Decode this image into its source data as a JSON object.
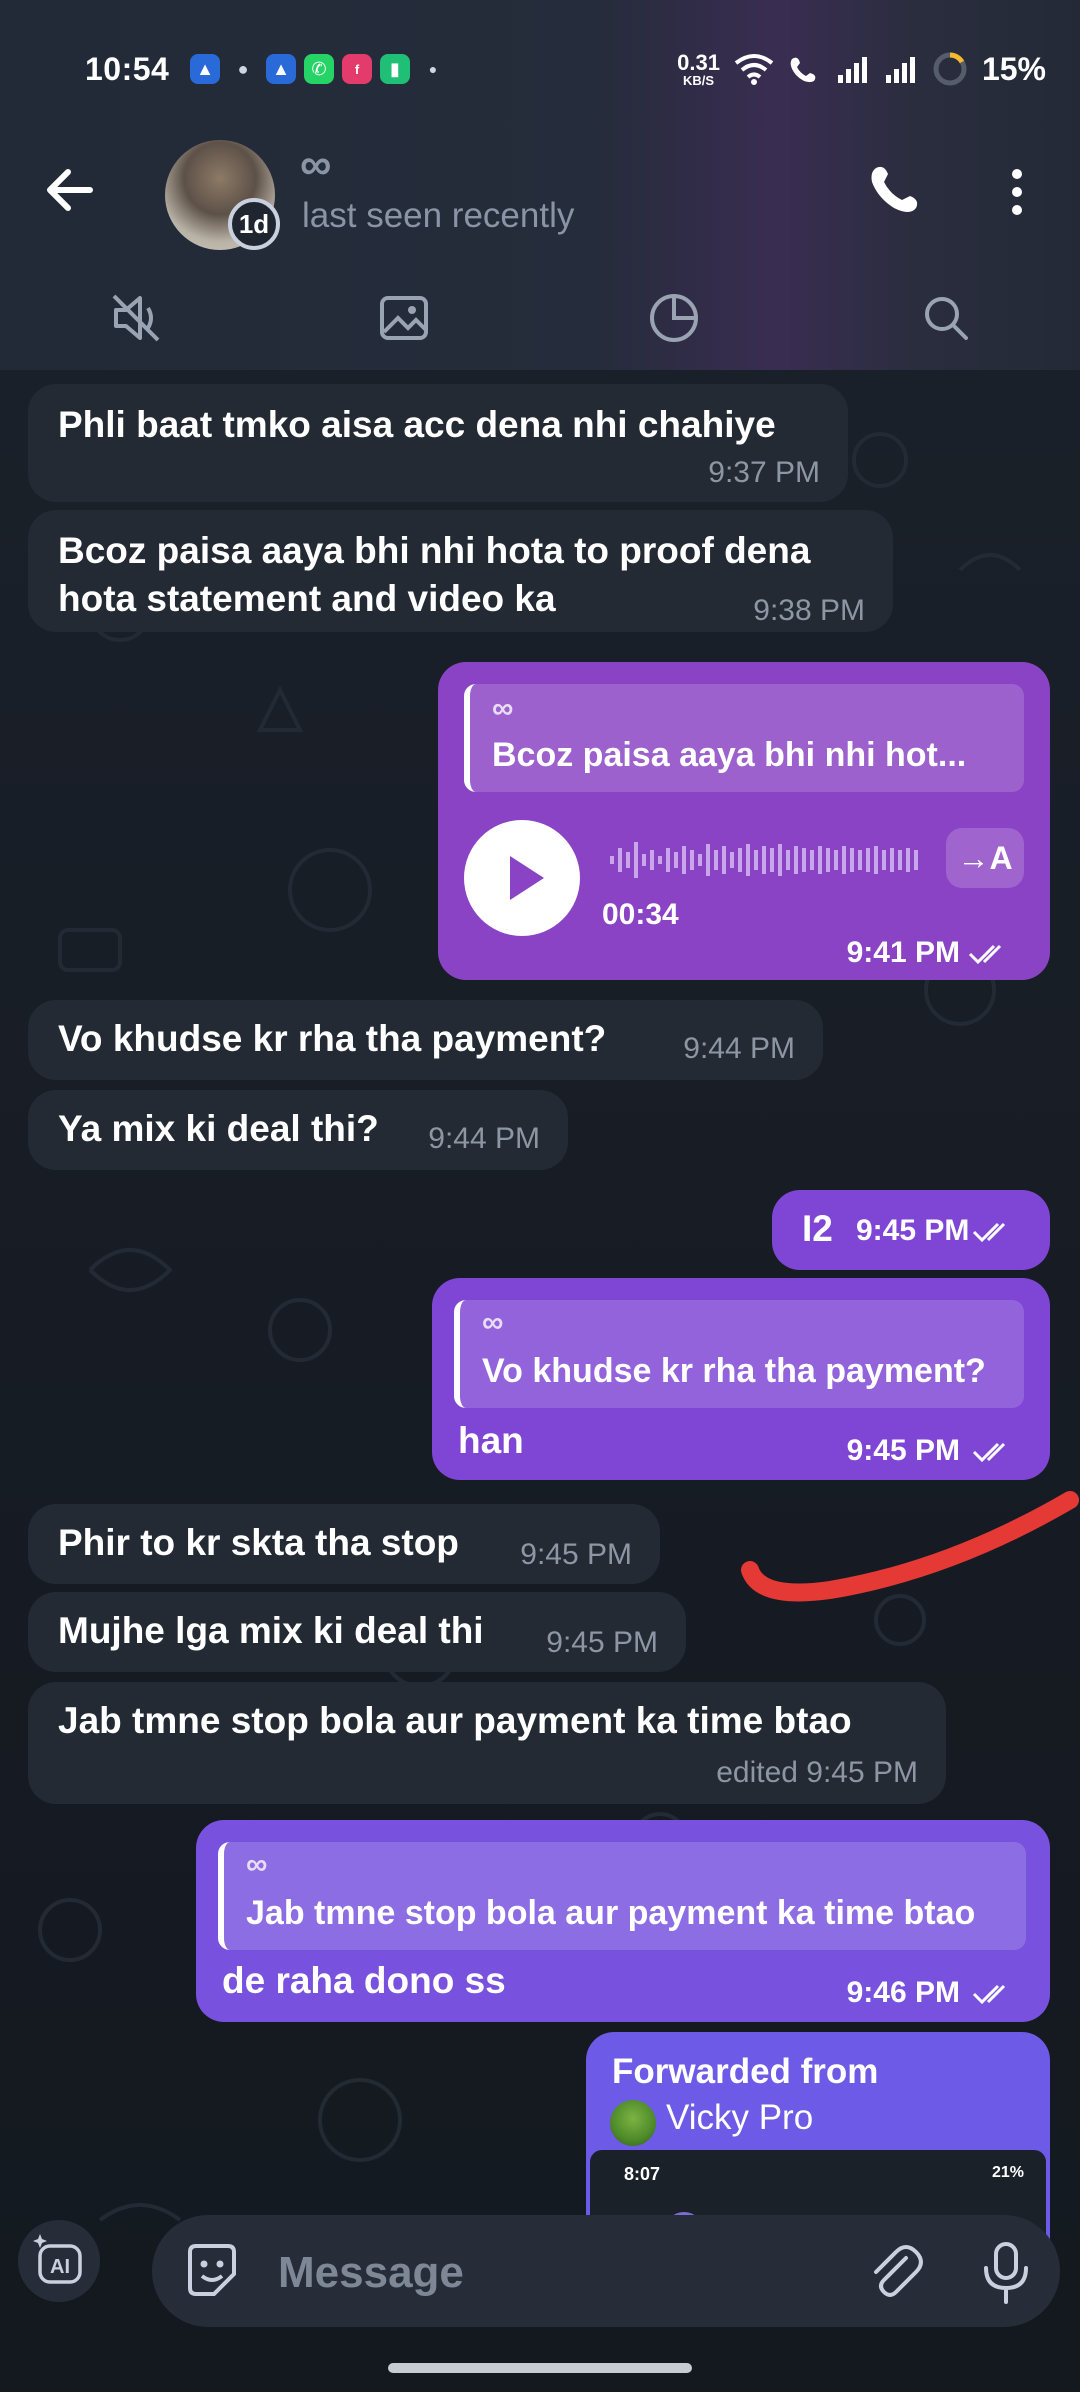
{
  "status_bar": {
    "time": "10:54",
    "network_speed": "0.31",
    "network_unit": "KB/S",
    "battery": "15%"
  },
  "header": {
    "contact_name": "∞",
    "contact_status": "last seen recently",
    "story_badge": "1d"
  },
  "messages": [
    {
      "dir": "in",
      "text": "Phli baat tmko aisa acc dena nhi chahiye",
      "time": "9:37 PM"
    },
    {
      "dir": "in",
      "text_line1": "Bcoz paisa aaya bhi nhi hota to proof dena",
      "text_line2": "hota statement and video ka",
      "time": "9:38 PM"
    },
    {
      "dir": "out",
      "type": "voice",
      "reply_name": "∞",
      "reply_text": "Bcoz paisa aaya bhi nhi hot...",
      "duration": "00:34",
      "transcribe": "→A",
      "time": "9:41 PM"
    },
    {
      "dir": "in",
      "text": "Vo khudse kr rha tha payment?",
      "time": "9:44 PM"
    },
    {
      "dir": "in",
      "text": "Ya mix ki deal thi?",
      "time": "9:44 PM"
    },
    {
      "dir": "out",
      "text": "I2",
      "time": "9:45 PM"
    },
    {
      "dir": "out",
      "reply_name": "∞",
      "reply_text": "Vo khudse kr rha tha payment?",
      "text": "han",
      "time": "9:45 PM"
    },
    {
      "dir": "in",
      "text": "Phir to kr skta tha stop",
      "time": "9:45 PM"
    },
    {
      "dir": "in",
      "text": "Mujhe lga mix ki deal thi",
      "time": "9:45 PM"
    },
    {
      "dir": "in",
      "text": "Jab tmne stop bola aur payment ka time btao",
      "time": "edited 9:45 PM"
    },
    {
      "dir": "out",
      "reply_name": "∞",
      "reply_text": "Jab tmne stop bola aur payment ka time btao",
      "text": "de raha dono ss",
      "time": "9:46 PM"
    },
    {
      "dir": "out",
      "type": "forward",
      "forward_label": "Forwarded from",
      "forward_name": "Vicky Pro",
      "preview_time": "8:07",
      "preview_battery": "21%"
    }
  ],
  "composer": {
    "ai_label": "AI",
    "placeholder": "Message"
  },
  "colors": {
    "bubble_in": "#232a33",
    "bubble_out": "#8a43c4",
    "annotation": "#e53935"
  }
}
